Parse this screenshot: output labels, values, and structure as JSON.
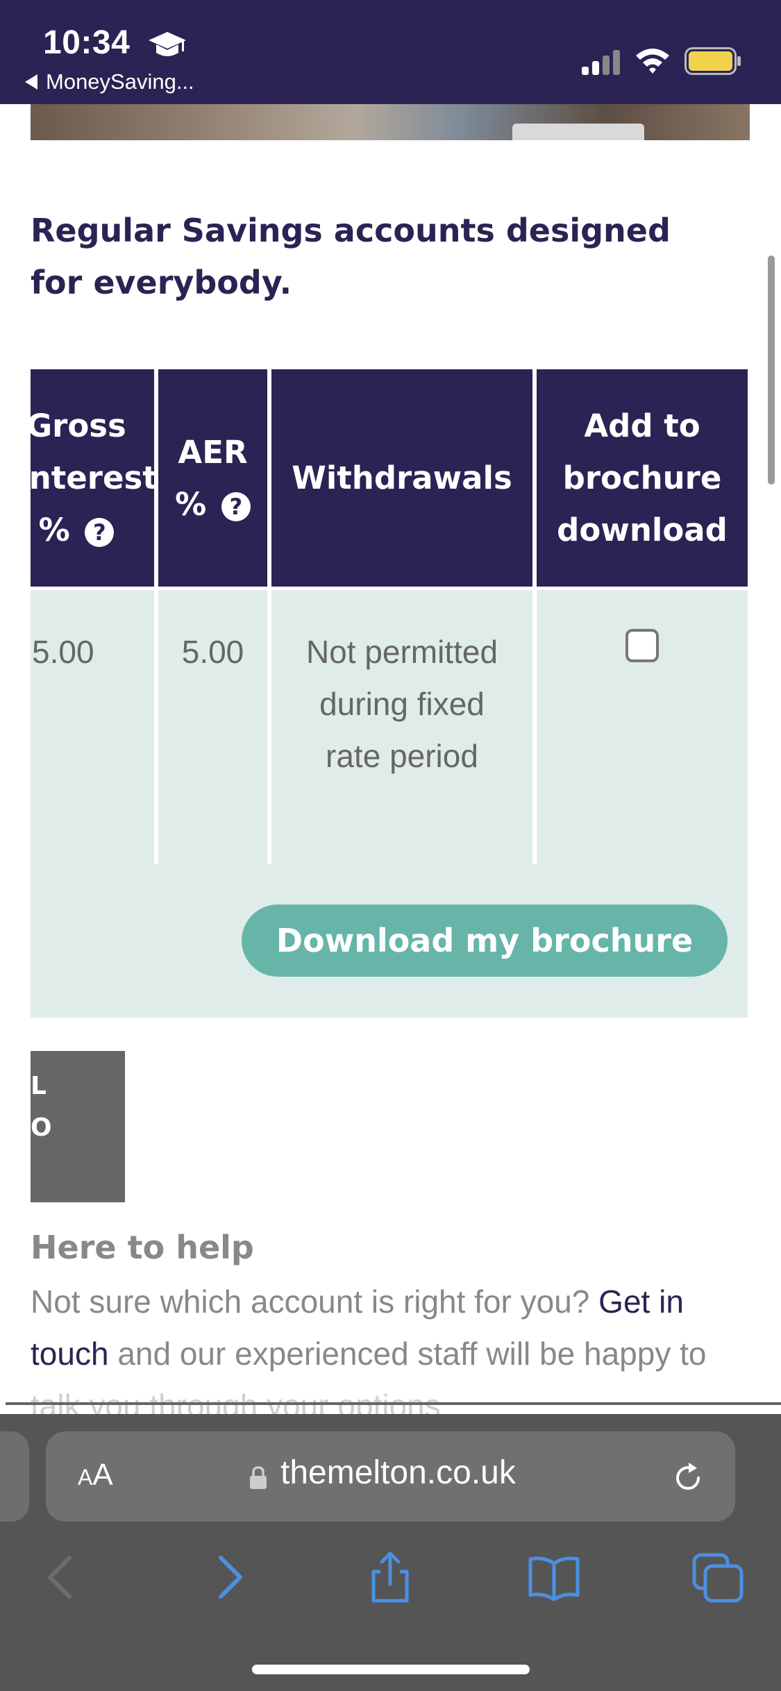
{
  "status_bar": {
    "time": "10:34",
    "back_app": "MoneySaving..."
  },
  "page": {
    "heading": "Regular Savings accounts designed for everybody."
  },
  "table": {
    "headers": {
      "gross_interest": "Gross Interest",
      "gross_interest_unit": "%",
      "aer": "AER",
      "aer_unit": "%",
      "withdrawals": "Withdrawals",
      "add_to_brochure": "Add to brochure download"
    },
    "row": {
      "gross_interest": "5.00",
      "aer": "5.00",
      "withdrawals": "Not permitted during fixed rate period",
      "add_to_brochure_checked": false
    },
    "help_icon": "question-circle-icon"
  },
  "download_button": "Download my brochure",
  "grey_box": {
    "line1": "L",
    "line2": "O"
  },
  "help": {
    "title": "Here to help",
    "text_before": "Not sure which account is right for you?",
    "link": "Get in touch",
    "text_after": "and our experienced staff will be happy to talk you through your options"
  },
  "browser": {
    "aa_label_big": "A",
    "aa_label_small": "A",
    "url": "themelton.co.uk"
  },
  "colors": {
    "brand_dark": "#2a2354",
    "accent_teal": "#66b5a8",
    "row_bg": "#e0ecea"
  }
}
